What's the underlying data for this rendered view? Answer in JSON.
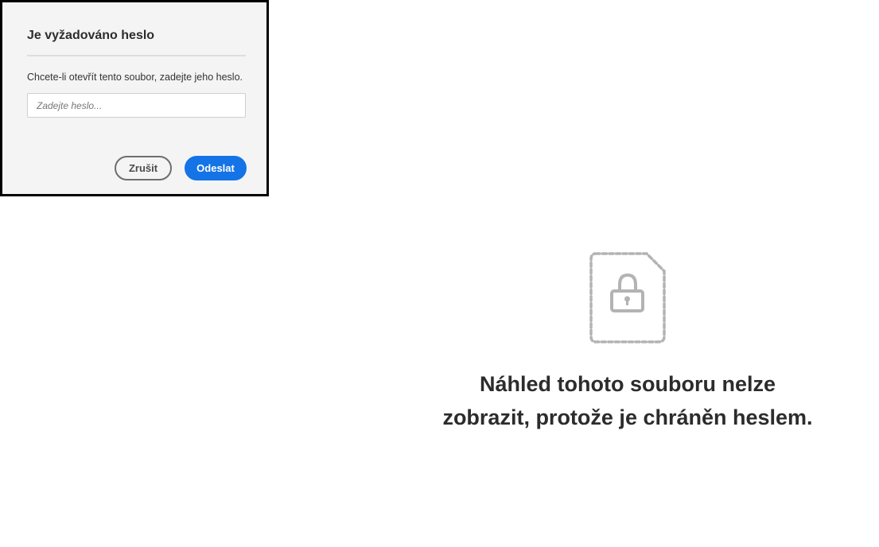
{
  "dialog": {
    "title": "Je vyžadováno heslo",
    "message": "Chcete-li otevřít tento soubor, zadejte jeho heslo.",
    "password_placeholder": "Zadejte heslo...",
    "password_value": "",
    "cancel_label": "Zrušit",
    "submit_label": "Odeslat"
  },
  "preview": {
    "icon": "locked-file-icon",
    "message_line1": "Náhled tohoto souboru nelze",
    "message_line2": "zobrazit, protože je chráněn heslem."
  },
  "colors": {
    "accent": "#1473e6",
    "dialog_background": "#f4f4f4",
    "icon_gray": "#b3b3b3",
    "text_dark": "#2c2c2c"
  }
}
